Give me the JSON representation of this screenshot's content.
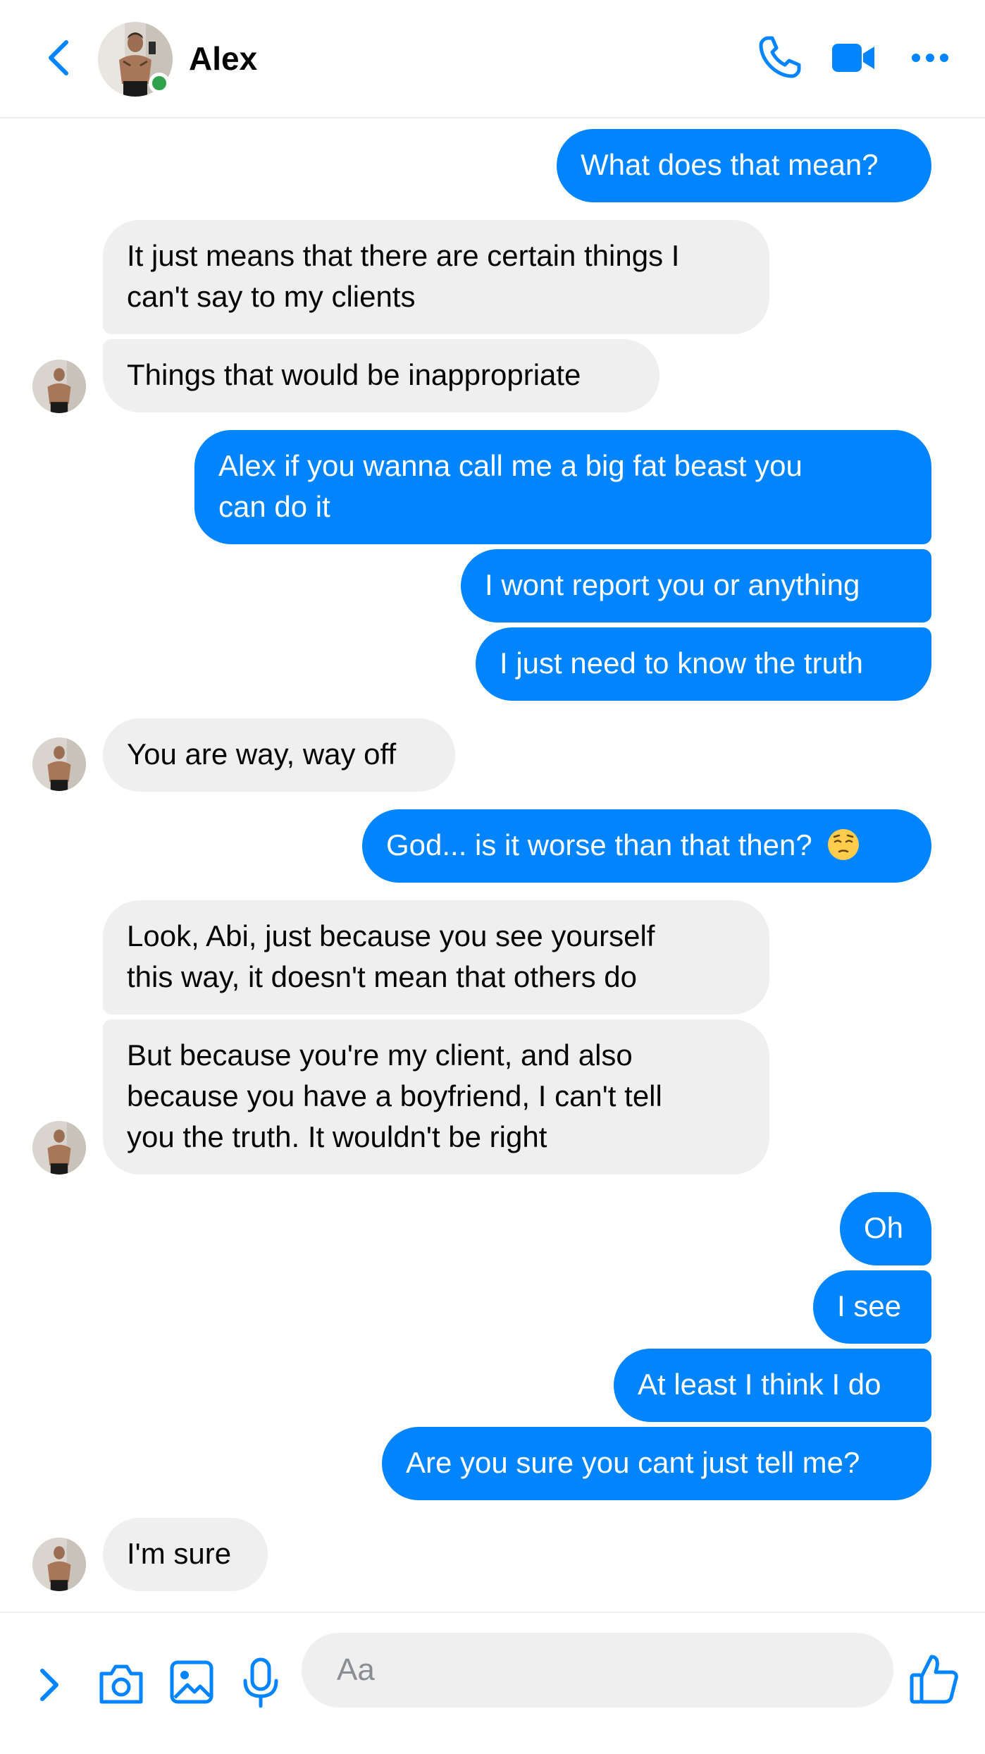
{
  "header": {
    "contact_name": "Alex",
    "online": true,
    "icons": [
      "back-chevron-icon",
      "phone-icon",
      "video-camera-icon",
      "more-horizontal-icon"
    ]
  },
  "colors": {
    "accent": "#0084ff",
    "received_bubble": "#efefef",
    "online_status": "#31a24c"
  },
  "messages": [
    {
      "from": "me",
      "text": "What does that mean?"
    },
    {
      "from": "alex",
      "text": "It just means that there are certain things I"
    },
    {
      "from": "alex",
      "text": "can't say to my clients"
    },
    {
      "from": "alex",
      "text": "Things that would be inappropriate"
    },
    {
      "from": "me",
      "text": "Alex if you wanna call me a big fat beast you"
    },
    {
      "from": "me",
      "text": "can do it"
    },
    {
      "from": "me",
      "text": "I wont report you or anything"
    },
    {
      "from": "me",
      "text": "I just need to know the truth"
    },
    {
      "from": "alex",
      "text": "You are way, way off"
    },
    {
      "from": "me",
      "text": "God... is it worse than that then?",
      "emoji": "pensive-face-emoji"
    },
    {
      "from": "alex",
      "text": "Look, Abi, just because you see yourself"
    },
    {
      "from": "alex",
      "text": "this way, it doesn't mean that others do"
    },
    {
      "from": "alex",
      "text": "But because you're my client, and also"
    },
    {
      "from": "alex",
      "text": "because you have a boyfriend, I can't tell"
    },
    {
      "from": "alex",
      "text": "you the truth. It wouldn't be right"
    },
    {
      "from": "me",
      "text": "Oh"
    },
    {
      "from": "me",
      "text": "I see"
    },
    {
      "from": "me",
      "text": "At least I think I do"
    },
    {
      "from": "me",
      "text": "Are you sure you cant just tell me?"
    },
    {
      "from": "alex",
      "text": "I'm sure"
    }
  ],
  "composer": {
    "placeholder": "Aa",
    "icons": [
      "expand-chevron-icon",
      "camera-icon",
      "gallery-icon",
      "microphone-icon",
      "thumbs-up-icon"
    ]
  }
}
